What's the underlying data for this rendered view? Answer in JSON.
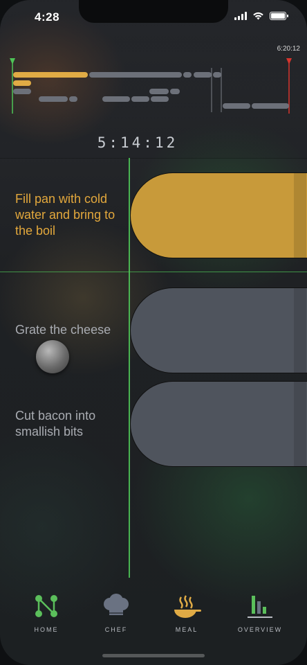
{
  "status": {
    "time": "4:28"
  },
  "timeline": {
    "end_time": "6:20:12",
    "elapsed": "5:14:12",
    "colors": {
      "active": "#e0ab45",
      "pending": "#6c7079",
      "now_marker": "#4ec457",
      "end_marker": "#d6352e"
    }
  },
  "tasks": [
    {
      "label": "Fill pan with cold water and bring to the boil",
      "state": "active"
    },
    {
      "label": "Grate the cheese",
      "state": "pending"
    },
    {
      "label": "Cut bacon into smallish bits",
      "state": "pending"
    }
  ],
  "tabs": [
    {
      "label": "HOME",
      "icon": "graph-nodes-icon"
    },
    {
      "label": "CHEF",
      "icon": "chef-hat-icon"
    },
    {
      "label": "MEAL",
      "icon": "steaming-pan-icon"
    },
    {
      "label": "OVERVIEW",
      "icon": "bar-chart-icon"
    }
  ]
}
